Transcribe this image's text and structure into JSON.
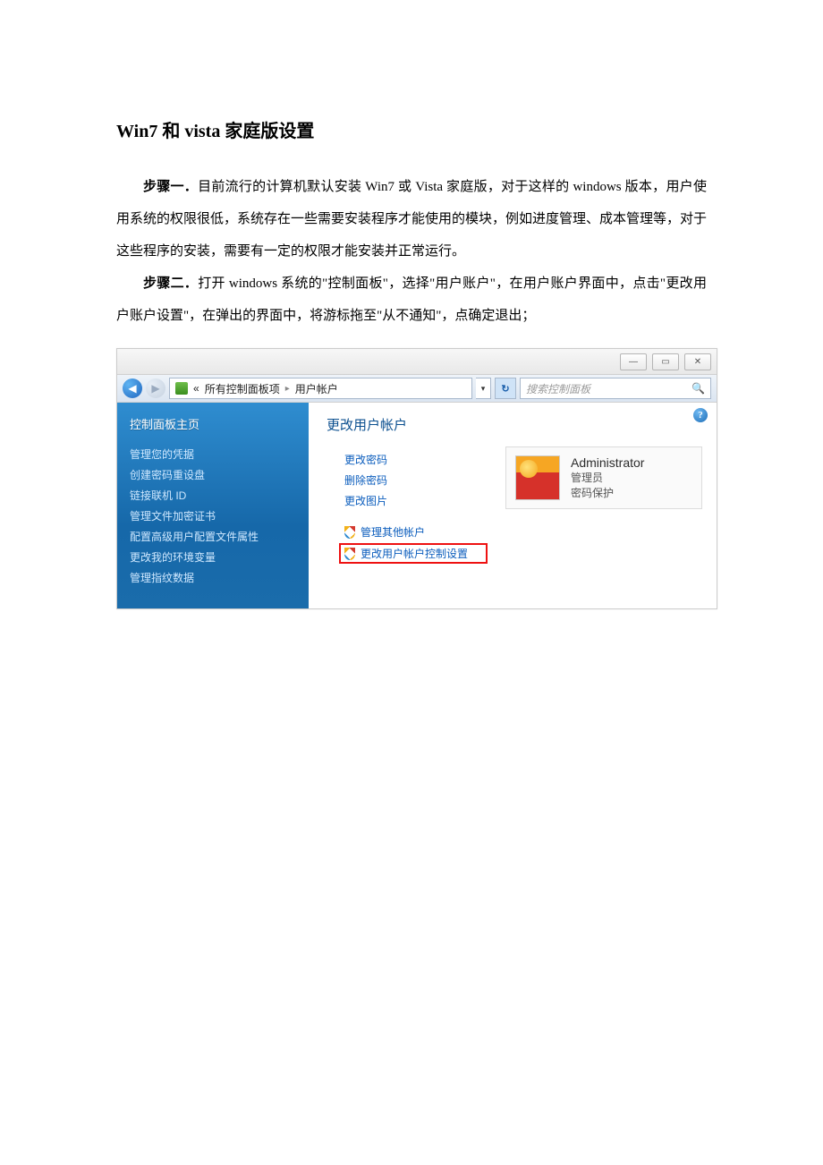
{
  "doc": {
    "title": "Win7 和 vista 家庭版设置",
    "step1_label": "步骤一．",
    "step1_text": "目前流行的计算机默认安装 Win7 或 Vista 家庭版，对于这样的 windows 版本，用户使用系统的权限很低，系统存在一些需要安装程序才能使用的模块，例如进度管理、成本管理等，对于这些程序的安装，需要有一定的权限才能安装并正常运行。",
    "step2_label": "步骤二．",
    "step2_text": "打开 windows 系统的\"控制面板\"，选择\"用户账户\"，在用户账户界面中，点击\"更改用户账户设置\"，在弹出的界面中，将游标拖至\"从不通知\"，点确定退出；"
  },
  "win": {
    "minimize": "—",
    "maximize": "▭",
    "close": "✕",
    "back": "◀",
    "forward": "▶",
    "breadcrumb_prefix": "«",
    "breadcrumb_1": "所有控制面板项",
    "breadcrumb_sep": "▸",
    "breadcrumb_2": "用户帐户",
    "dd": "▾",
    "refresh": "↻",
    "search_placeholder": "搜索控制面板",
    "search_icon": "🔍",
    "help": "?",
    "sidebar": {
      "home": "控制面板主页",
      "links": [
        "管理您的凭据",
        "创建密码重设盘",
        "链接联机 ID",
        "管理文件加密证书",
        "配置高级用户配置文件属性",
        "更改我的环境变量",
        "管理指纹数据"
      ]
    },
    "main": {
      "section_title": "更改用户帐户",
      "tasks1": [
        "更改密码",
        "删除密码",
        "更改图片"
      ],
      "tasks2": [
        "管理其他帐户",
        "更改用户帐户控制设置"
      ],
      "account": {
        "name": "Administrator",
        "role": "管理员",
        "pw": "密码保护"
      }
    }
  }
}
